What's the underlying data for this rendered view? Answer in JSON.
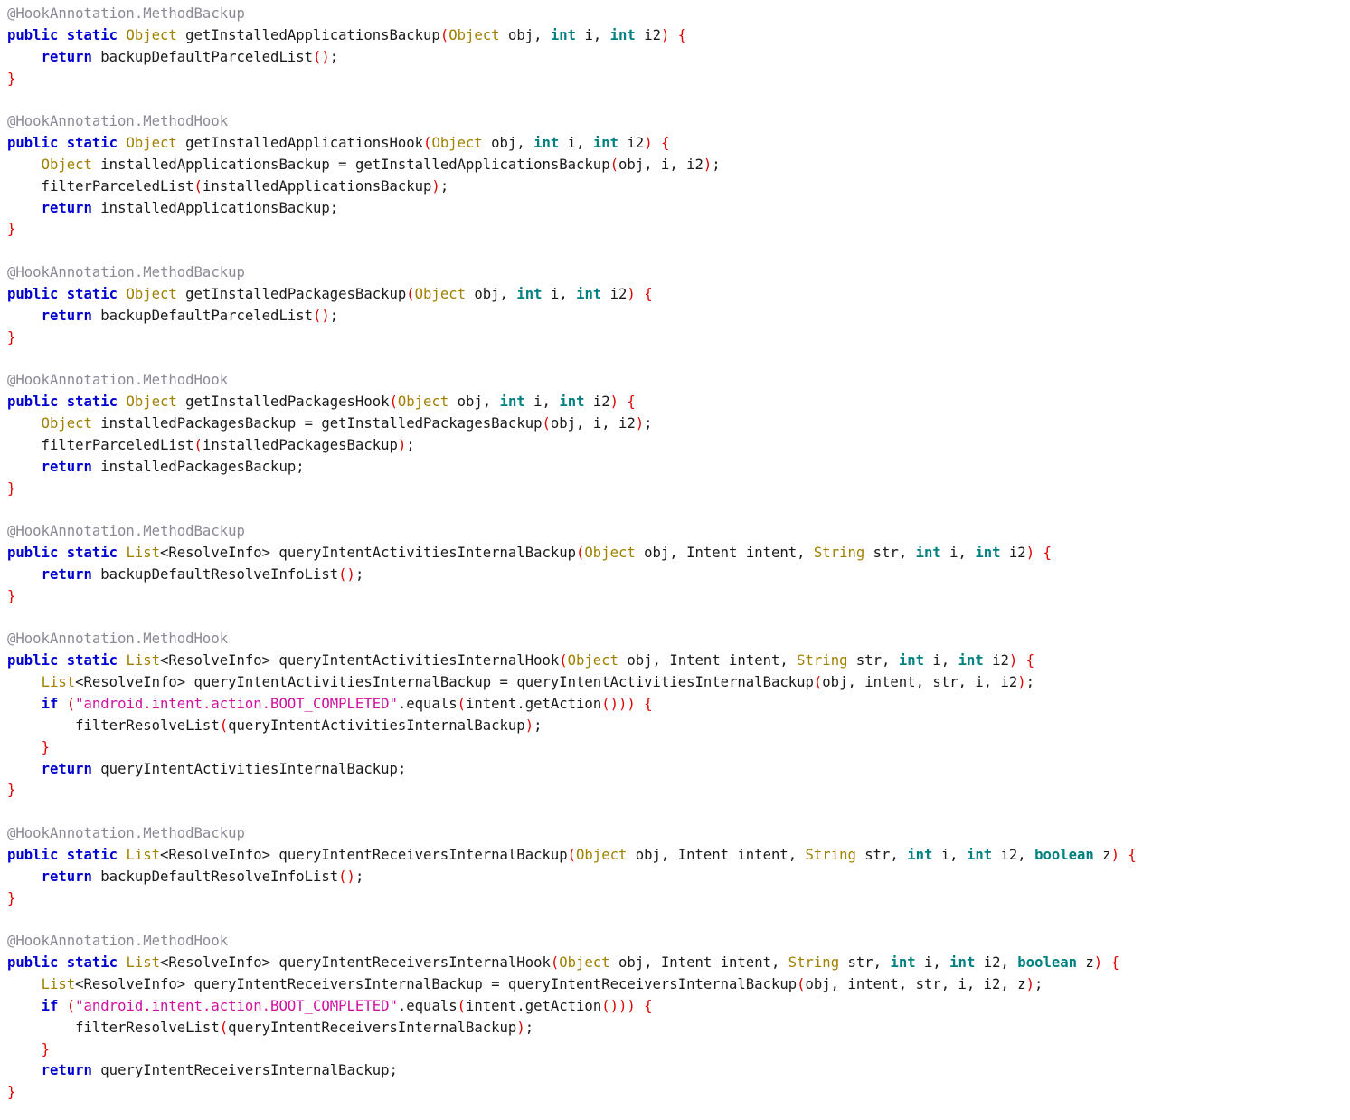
{
  "editor": {
    "language": "java",
    "background": "#ffffff",
    "font_size_px": 15.6,
    "line_height_px": 23.85
  },
  "theme": {
    "keyword": "#0000d0",
    "primitive_type": "#008080",
    "class_type": "#a08000",
    "identifier": "#1a1a1a",
    "punctuation": "#e00000",
    "string_literal": "#d010a0",
    "annotation": "#8a8a96"
  },
  "annotations": {
    "method_backup": "@HookAnnotation.MethodBackup",
    "method_hook": "@HookAnnotation.MethodHook"
  },
  "code_lines": [
    [
      {
        "t": "@HookAnnotation.MethodBackup",
        "c": "ann"
      }
    ],
    [
      {
        "t": "public static ",
        "c": "kw"
      },
      {
        "t": "Object",
        "c": "type"
      },
      {
        "t": " getInstalledApplicationsBackup",
        "c": "plain"
      },
      {
        "t": "(",
        "c": "punc"
      },
      {
        "t": "Object",
        "c": "type"
      },
      {
        "t": " obj, ",
        "c": "plain"
      },
      {
        "t": "int",
        "c": "prim"
      },
      {
        "t": " i, ",
        "c": "plain"
      },
      {
        "t": "int",
        "c": "prim"
      },
      {
        "t": " i2",
        "c": "plain"
      },
      {
        "t": ") {",
        "c": "punc"
      }
    ],
    [
      {
        "t": "    ",
        "c": "plain"
      },
      {
        "t": "return",
        "c": "kw"
      },
      {
        "t": " backupDefaultParceledList",
        "c": "plain"
      },
      {
        "t": "()",
        "c": "punc"
      },
      {
        "t": ";",
        "c": "plain"
      }
    ],
    [
      {
        "t": "}",
        "c": "punc"
      }
    ],
    [],
    [
      {
        "t": "@HookAnnotation.MethodHook",
        "c": "ann"
      }
    ],
    [
      {
        "t": "public static ",
        "c": "kw"
      },
      {
        "t": "Object",
        "c": "type"
      },
      {
        "t": " getInstalledApplicationsHook",
        "c": "plain"
      },
      {
        "t": "(",
        "c": "punc"
      },
      {
        "t": "Object",
        "c": "type"
      },
      {
        "t": " obj, ",
        "c": "plain"
      },
      {
        "t": "int",
        "c": "prim"
      },
      {
        "t": " i, ",
        "c": "plain"
      },
      {
        "t": "int",
        "c": "prim"
      },
      {
        "t": " i2",
        "c": "plain"
      },
      {
        "t": ") {",
        "c": "punc"
      }
    ],
    [
      {
        "t": "    ",
        "c": "plain"
      },
      {
        "t": "Object",
        "c": "type"
      },
      {
        "t": " installedApplicationsBackup = getInstalledApplicationsBackup",
        "c": "plain"
      },
      {
        "t": "(",
        "c": "punc"
      },
      {
        "t": "obj, i, i2",
        "c": "plain"
      },
      {
        "t": ")",
        "c": "punc"
      },
      {
        "t": ";",
        "c": "plain"
      }
    ],
    [
      {
        "t": "    filterParceledList",
        "c": "plain"
      },
      {
        "t": "(",
        "c": "punc"
      },
      {
        "t": "installedApplicationsBackup",
        "c": "plain"
      },
      {
        "t": ")",
        "c": "punc"
      },
      {
        "t": ";",
        "c": "plain"
      }
    ],
    [
      {
        "t": "    ",
        "c": "plain"
      },
      {
        "t": "return",
        "c": "kw"
      },
      {
        "t": " installedApplicationsBackup;",
        "c": "plain"
      }
    ],
    [
      {
        "t": "}",
        "c": "punc"
      }
    ],
    [],
    [
      {
        "t": "@HookAnnotation.MethodBackup",
        "c": "ann"
      }
    ],
    [
      {
        "t": "public static ",
        "c": "kw"
      },
      {
        "t": "Object",
        "c": "type"
      },
      {
        "t": " getInstalledPackagesBackup",
        "c": "plain"
      },
      {
        "t": "(",
        "c": "punc"
      },
      {
        "t": "Object",
        "c": "type"
      },
      {
        "t": " obj, ",
        "c": "plain"
      },
      {
        "t": "int",
        "c": "prim"
      },
      {
        "t": " i, ",
        "c": "plain"
      },
      {
        "t": "int",
        "c": "prim"
      },
      {
        "t": " i2",
        "c": "plain"
      },
      {
        "t": ") {",
        "c": "punc"
      }
    ],
    [
      {
        "t": "    ",
        "c": "plain"
      },
      {
        "t": "return",
        "c": "kw"
      },
      {
        "t": " backupDefaultParceledList",
        "c": "plain"
      },
      {
        "t": "()",
        "c": "punc"
      },
      {
        "t": ";",
        "c": "plain"
      }
    ],
    [
      {
        "t": "}",
        "c": "punc"
      }
    ],
    [],
    [
      {
        "t": "@HookAnnotation.MethodHook",
        "c": "ann"
      }
    ],
    [
      {
        "t": "public static ",
        "c": "kw"
      },
      {
        "t": "Object",
        "c": "type"
      },
      {
        "t": " getInstalledPackagesHook",
        "c": "plain"
      },
      {
        "t": "(",
        "c": "punc"
      },
      {
        "t": "Object",
        "c": "type"
      },
      {
        "t": " obj, ",
        "c": "plain"
      },
      {
        "t": "int",
        "c": "prim"
      },
      {
        "t": " i, ",
        "c": "plain"
      },
      {
        "t": "int",
        "c": "prim"
      },
      {
        "t": " i2",
        "c": "plain"
      },
      {
        "t": ") {",
        "c": "punc"
      }
    ],
    [
      {
        "t": "    ",
        "c": "plain"
      },
      {
        "t": "Object",
        "c": "type"
      },
      {
        "t": " installedPackagesBackup = getInstalledPackagesBackup",
        "c": "plain"
      },
      {
        "t": "(",
        "c": "punc"
      },
      {
        "t": "obj, i, i2",
        "c": "plain"
      },
      {
        "t": ")",
        "c": "punc"
      },
      {
        "t": ";",
        "c": "plain"
      }
    ],
    [
      {
        "t": "    filterParceledList",
        "c": "plain"
      },
      {
        "t": "(",
        "c": "punc"
      },
      {
        "t": "installedPackagesBackup",
        "c": "plain"
      },
      {
        "t": ")",
        "c": "punc"
      },
      {
        "t": ";",
        "c": "plain"
      }
    ],
    [
      {
        "t": "    ",
        "c": "plain"
      },
      {
        "t": "return",
        "c": "kw"
      },
      {
        "t": " installedPackagesBackup;",
        "c": "plain"
      }
    ],
    [
      {
        "t": "}",
        "c": "punc"
      }
    ],
    [],
    [
      {
        "t": "@HookAnnotation.MethodBackup",
        "c": "ann"
      }
    ],
    [
      {
        "t": "public static ",
        "c": "kw"
      },
      {
        "t": "List",
        "c": "type"
      },
      {
        "t": "<ResolveInfo> queryIntentActivitiesInternalBackup",
        "c": "plain"
      },
      {
        "t": "(",
        "c": "punc"
      },
      {
        "t": "Object",
        "c": "type"
      },
      {
        "t": " obj, Intent intent, ",
        "c": "plain"
      },
      {
        "t": "String",
        "c": "type"
      },
      {
        "t": " str, ",
        "c": "plain"
      },
      {
        "t": "int",
        "c": "prim"
      },
      {
        "t": " i, ",
        "c": "plain"
      },
      {
        "t": "int",
        "c": "prim"
      },
      {
        "t": " i2",
        "c": "plain"
      },
      {
        "t": ") {",
        "c": "punc"
      }
    ],
    [
      {
        "t": "    ",
        "c": "plain"
      },
      {
        "t": "return",
        "c": "kw"
      },
      {
        "t": " backupDefaultResolveInfoList",
        "c": "plain"
      },
      {
        "t": "()",
        "c": "punc"
      },
      {
        "t": ";",
        "c": "plain"
      }
    ],
    [
      {
        "t": "}",
        "c": "punc"
      }
    ],
    [],
    [
      {
        "t": "@HookAnnotation.MethodHook",
        "c": "ann"
      }
    ],
    [
      {
        "t": "public static ",
        "c": "kw"
      },
      {
        "t": "List",
        "c": "type"
      },
      {
        "t": "<ResolveInfo> queryIntentActivitiesInternalHook",
        "c": "plain"
      },
      {
        "t": "(",
        "c": "punc"
      },
      {
        "t": "Object",
        "c": "type"
      },
      {
        "t": " obj, Intent intent, ",
        "c": "plain"
      },
      {
        "t": "String",
        "c": "type"
      },
      {
        "t": " str, ",
        "c": "plain"
      },
      {
        "t": "int",
        "c": "prim"
      },
      {
        "t": " i, ",
        "c": "plain"
      },
      {
        "t": "int",
        "c": "prim"
      },
      {
        "t": " i2",
        "c": "plain"
      },
      {
        "t": ") {",
        "c": "punc"
      }
    ],
    [
      {
        "t": "    ",
        "c": "plain"
      },
      {
        "t": "List",
        "c": "type"
      },
      {
        "t": "<ResolveInfo> queryIntentActivitiesInternalBackup = queryIntentActivitiesInternalBackup",
        "c": "plain"
      },
      {
        "t": "(",
        "c": "punc"
      },
      {
        "t": "obj, intent, str, i, i2",
        "c": "plain"
      },
      {
        "t": ")",
        "c": "punc"
      },
      {
        "t": ";",
        "c": "plain"
      }
    ],
    [
      {
        "t": "    ",
        "c": "plain"
      },
      {
        "t": "if",
        "c": "kw"
      },
      {
        "t": " ",
        "c": "plain"
      },
      {
        "t": "(",
        "c": "punc"
      },
      {
        "t": "\"android.intent.action.BOOT_COMPLETED\"",
        "c": "str"
      },
      {
        "t": ".equals",
        "c": "plain"
      },
      {
        "t": "(",
        "c": "punc"
      },
      {
        "t": "intent.getAction",
        "c": "plain"
      },
      {
        "t": "()))",
        "c": "punc"
      },
      {
        "t": " ",
        "c": "plain"
      },
      {
        "t": "{",
        "c": "punc"
      }
    ],
    [
      {
        "t": "        filterResolveList",
        "c": "plain"
      },
      {
        "t": "(",
        "c": "punc"
      },
      {
        "t": "queryIntentActivitiesInternalBackup",
        "c": "plain"
      },
      {
        "t": ")",
        "c": "punc"
      },
      {
        "t": ";",
        "c": "plain"
      }
    ],
    [
      {
        "t": "    ",
        "c": "plain"
      },
      {
        "t": "}",
        "c": "punc"
      }
    ],
    [
      {
        "t": "    ",
        "c": "plain"
      },
      {
        "t": "return",
        "c": "kw"
      },
      {
        "t": " queryIntentActivitiesInternalBackup;",
        "c": "plain"
      }
    ],
    [
      {
        "t": "}",
        "c": "punc"
      }
    ],
    [],
    [
      {
        "t": "@HookAnnotation.MethodBackup",
        "c": "ann"
      }
    ],
    [
      {
        "t": "public static ",
        "c": "kw"
      },
      {
        "t": "List",
        "c": "type"
      },
      {
        "t": "<ResolveInfo> queryIntentReceiversInternalBackup",
        "c": "plain"
      },
      {
        "t": "(",
        "c": "punc"
      },
      {
        "t": "Object",
        "c": "type"
      },
      {
        "t": " obj, Intent intent, ",
        "c": "plain"
      },
      {
        "t": "String",
        "c": "type"
      },
      {
        "t": " str, ",
        "c": "plain"
      },
      {
        "t": "int",
        "c": "prim"
      },
      {
        "t": " i, ",
        "c": "plain"
      },
      {
        "t": "int",
        "c": "prim"
      },
      {
        "t": " i2, ",
        "c": "plain"
      },
      {
        "t": "boolean",
        "c": "prim"
      },
      {
        "t": " z",
        "c": "plain"
      },
      {
        "t": ") {",
        "c": "punc"
      }
    ],
    [
      {
        "t": "    ",
        "c": "plain"
      },
      {
        "t": "return",
        "c": "kw"
      },
      {
        "t": " backupDefaultResolveInfoList",
        "c": "plain"
      },
      {
        "t": "()",
        "c": "punc"
      },
      {
        "t": ";",
        "c": "plain"
      }
    ],
    [
      {
        "t": "}",
        "c": "punc"
      }
    ],
    [],
    [
      {
        "t": "@HookAnnotation.MethodHook",
        "c": "ann"
      }
    ],
    [
      {
        "t": "public static ",
        "c": "kw"
      },
      {
        "t": "List",
        "c": "type"
      },
      {
        "t": "<ResolveInfo> queryIntentReceiversInternalHook",
        "c": "plain"
      },
      {
        "t": "(",
        "c": "punc"
      },
      {
        "t": "Object",
        "c": "type"
      },
      {
        "t": " obj, Intent intent, ",
        "c": "plain"
      },
      {
        "t": "String",
        "c": "type"
      },
      {
        "t": " str, ",
        "c": "plain"
      },
      {
        "t": "int",
        "c": "prim"
      },
      {
        "t": " i, ",
        "c": "plain"
      },
      {
        "t": "int",
        "c": "prim"
      },
      {
        "t": " i2, ",
        "c": "plain"
      },
      {
        "t": "boolean",
        "c": "prim"
      },
      {
        "t": " z",
        "c": "plain"
      },
      {
        "t": ") {",
        "c": "punc"
      }
    ],
    [
      {
        "t": "    ",
        "c": "plain"
      },
      {
        "t": "List",
        "c": "type"
      },
      {
        "t": "<ResolveInfo> queryIntentReceiversInternalBackup = queryIntentReceiversInternalBackup",
        "c": "plain"
      },
      {
        "t": "(",
        "c": "punc"
      },
      {
        "t": "obj, intent, str, i, i2, z",
        "c": "plain"
      },
      {
        "t": ")",
        "c": "punc"
      },
      {
        "t": ";",
        "c": "plain"
      }
    ],
    [
      {
        "t": "    ",
        "c": "plain"
      },
      {
        "t": "if",
        "c": "kw"
      },
      {
        "t": " ",
        "c": "plain"
      },
      {
        "t": "(",
        "c": "punc"
      },
      {
        "t": "\"android.intent.action.BOOT_COMPLETED\"",
        "c": "str"
      },
      {
        "t": ".equals",
        "c": "plain"
      },
      {
        "t": "(",
        "c": "punc"
      },
      {
        "t": "intent.getAction",
        "c": "plain"
      },
      {
        "t": "()))",
        "c": "punc"
      },
      {
        "t": " ",
        "c": "plain"
      },
      {
        "t": "{",
        "c": "punc"
      }
    ],
    [
      {
        "t": "        filterResolveList",
        "c": "plain"
      },
      {
        "t": "(",
        "c": "punc"
      },
      {
        "t": "queryIntentReceiversInternalBackup",
        "c": "plain"
      },
      {
        "t": ")",
        "c": "punc"
      },
      {
        "t": ";",
        "c": "plain"
      }
    ],
    [
      {
        "t": "    ",
        "c": "plain"
      },
      {
        "t": "}",
        "c": "punc"
      }
    ],
    [
      {
        "t": "    ",
        "c": "plain"
      },
      {
        "t": "return",
        "c": "kw"
      },
      {
        "t": " queryIntentReceiversInternalBackup;",
        "c": "plain"
      }
    ],
    [
      {
        "t": "}",
        "c": "punc"
      }
    ]
  ]
}
